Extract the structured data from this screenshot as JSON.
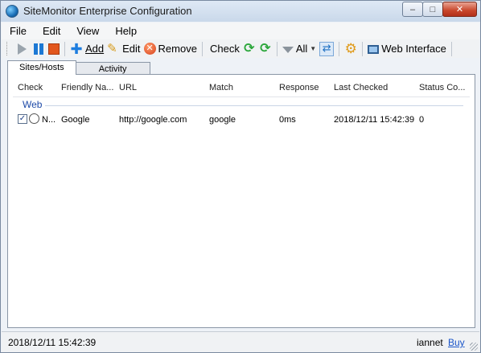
{
  "window": {
    "title": "SiteMonitor Enterprise Configuration",
    "minimize": "–",
    "maximize": "□",
    "close": "✕"
  },
  "menu": [
    "File",
    "Edit",
    "View",
    "Help"
  ],
  "toolbar": {
    "add_label": "Add",
    "edit_label": "Edit",
    "remove_label": "Remove",
    "check_label": "Check",
    "filter_label": "All",
    "web_interface_label": "Web Interface"
  },
  "tabs": [
    {
      "label": "Sites/Hosts",
      "active": true
    },
    {
      "label": "Activity",
      "active": false
    }
  ],
  "list": {
    "columns": [
      "Check",
      "Friendly Na...",
      "URL",
      "Match",
      "Response",
      "Last Checked",
      "Status Co..."
    ],
    "group": "Web",
    "rows": [
      {
        "checked": true,
        "check_text": "N...",
        "friendly_name": "Google",
        "url": "http://google.com",
        "match": "google",
        "response": "0ms",
        "last_checked": "2018/12/11 15:42:39",
        "status_code": "0"
      }
    ]
  },
  "statusbar": {
    "time": "2018/12/11 15:42:39",
    "user": "iannet",
    "buy_link": "Buy"
  },
  "colors": {
    "group_text": "#1e4aa8",
    "link": "#1a55c9",
    "stop": "#e2571e",
    "pause": "#1c78d4"
  }
}
